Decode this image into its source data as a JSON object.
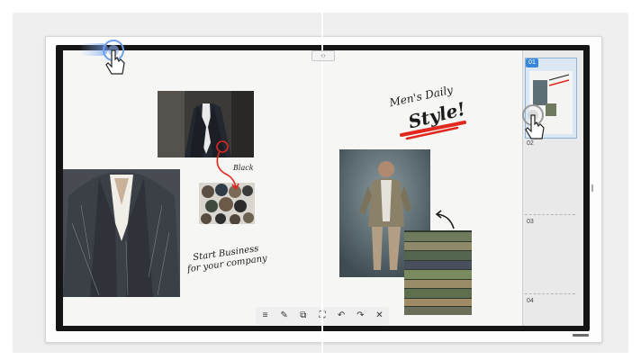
{
  "canvas": {
    "annotations": {
      "black": "Black",
      "headline_line1": "Men's Daily",
      "headline_line2": "Style!",
      "note_line1": "Start Business",
      "note_line2": "for your company"
    }
  },
  "pages": {
    "items": [
      {
        "label": "01",
        "selected": true
      },
      {
        "label": "02"
      },
      {
        "label": "03"
      },
      {
        "label": "04"
      }
    ]
  },
  "toolbar": {
    "items": [
      {
        "icon": "menu-icon"
      },
      {
        "icon": "note-icon"
      },
      {
        "icon": "copy-icon"
      },
      {
        "icon": "capture-icon"
      },
      {
        "icon": "undo-icon"
      },
      {
        "icon": "redo-icon"
      },
      {
        "icon": "close-icon"
      }
    ]
  },
  "colors": {
    "accent": "#3a86d8",
    "highlight_red": "#e0281f",
    "bezel": "#151515"
  }
}
